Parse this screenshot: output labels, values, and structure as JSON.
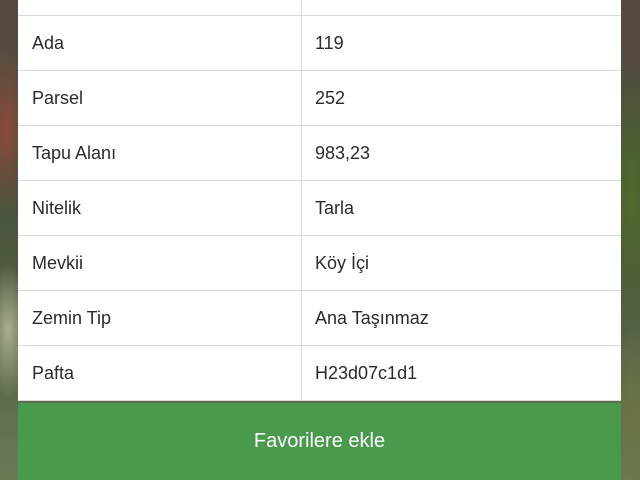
{
  "table": {
    "rows": [
      {
        "label": "",
        "value": ""
      },
      {
        "label": "Ada",
        "value": "119"
      },
      {
        "label": "Parsel",
        "value": "252"
      },
      {
        "label": "Tapu Alanı",
        "value": "983,23"
      },
      {
        "label": "Nitelik",
        "value": "Tarla"
      },
      {
        "label": "Mevkii",
        "value": "Köy İçi"
      },
      {
        "label": "Zemin Tip",
        "value": "Ana Taşınmaz"
      },
      {
        "label": "Pafta",
        "value": "H23d07c1d1"
      }
    ]
  },
  "actions": {
    "favorite_label": "Favorilere ekle"
  },
  "colors": {
    "button_green": "#4a9a4e",
    "divider": "#d9d9d9",
    "text": "#2b2b2b"
  }
}
